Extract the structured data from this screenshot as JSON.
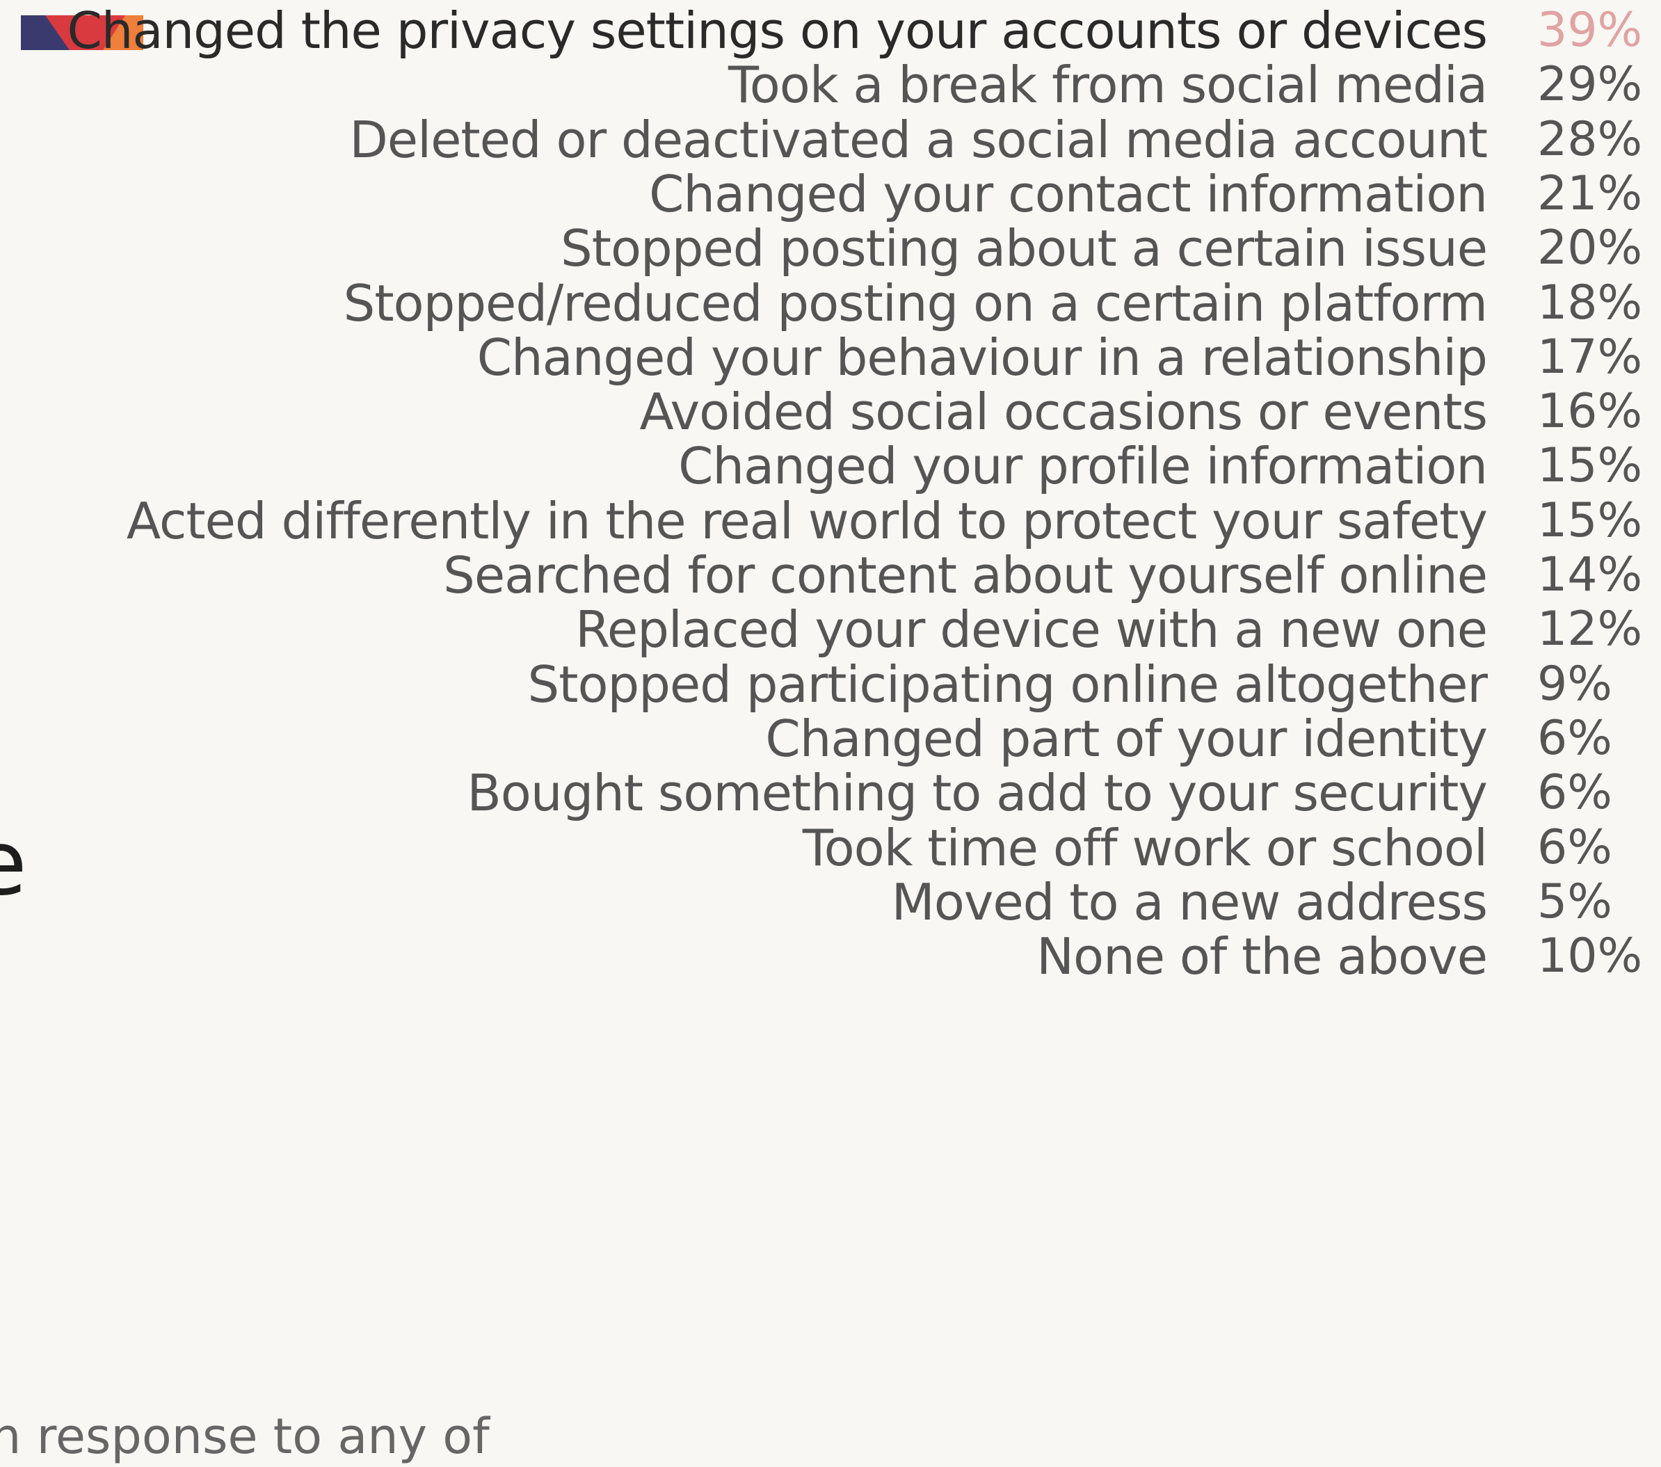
{
  "chart_data": {
    "type": "bar",
    "categories": [
      "Changed the privacy settings on your accounts or devices",
      "Took a break from social media",
      "Deleted or deactivated a social media account",
      "Changed your contact information",
      "Stopped posting about a certain issue",
      "Stopped/reduced posting on a certain platform",
      "Changed your behaviour in a relationship",
      "Avoided social occasions or events",
      "Changed your profile information",
      "Acted differently in the real world to protect your safety",
      "Searched for content about yourself online",
      "Replaced your device with a new one",
      "Stopped participating online altogether",
      "Changed part of your identity",
      "Bought something to add to your security",
      "Took time off work or school",
      "Moved to a new address",
      "None of the above"
    ],
    "values": [
      39,
      29,
      28,
      21,
      20,
      18,
      17,
      16,
      15,
      15,
      14,
      12,
      9,
      6,
      6,
      6,
      5,
      10
    ],
    "value_labels": [
      "39%",
      "29%",
      "28%",
      "21%",
      "20%",
      "18%",
      "17%",
      "16%",
      "15%",
      "15%",
      "14%",
      "12%",
      "9%",
      "6%",
      "6%",
      "6%",
      "5%",
      "10%"
    ],
    "highlight_index": 0,
    "colors": {
      "background": "#f8f7f3",
      "label": "#555555",
      "highlight_label": "#2a2a2a",
      "highlight_value": "#e0a3a3",
      "flag_navy": "#3b3a6e",
      "flag_red": "#d93a3f",
      "flag_orange": "#ef7f3a"
    }
  },
  "partial_text": {
    "left_letter": "e",
    "bottom_left": "n response to any of"
  }
}
